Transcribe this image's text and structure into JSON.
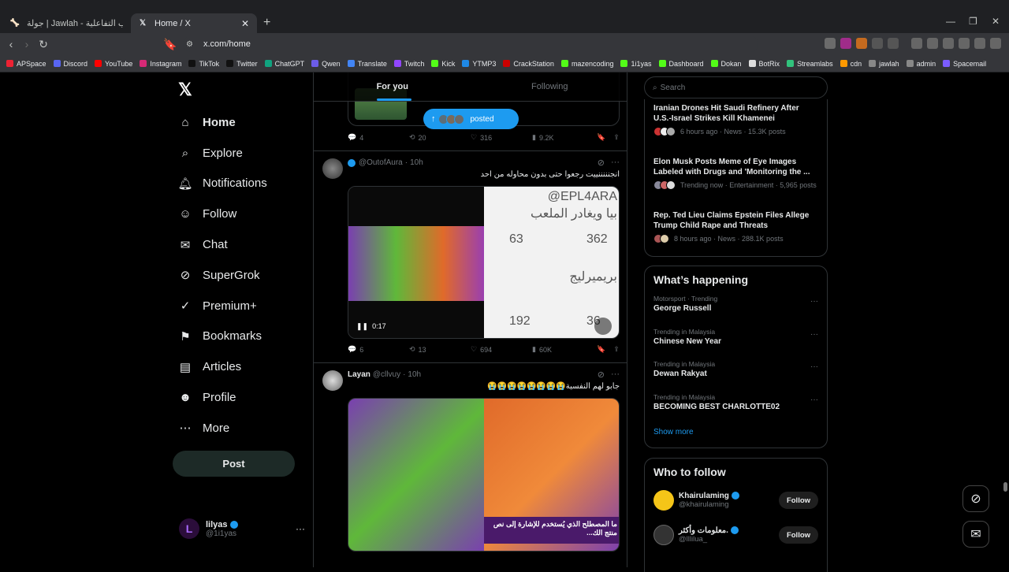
{
  "browser": {
    "tabs": [
      {
        "title": "جولة | Jawlah - منصة الألعاب التفاعلية",
        "icon": "jawlah-icon"
      },
      {
        "title": "Home / X",
        "icon": "x-icon"
      }
    ],
    "url": "x.com/home",
    "bookmarks": [
      "APSpace",
      "Discord",
      "YouTube",
      "Instagram",
      "TikTok",
      "Twitter",
      "ChatGPT",
      "Qwen",
      "Translate",
      "Twitch",
      "Kick",
      "YTMP3",
      "CrackStation",
      "mazencoding",
      "1i1yas",
      "Dashboard",
      "Dokan",
      "BotRix",
      "Streamlabs",
      "cdn",
      "jawlah",
      "admin",
      "Spacemail"
    ]
  },
  "nav": {
    "items": [
      {
        "label": "Home",
        "icon": "home-icon"
      },
      {
        "label": "Explore",
        "icon": "search-icon"
      },
      {
        "label": "Notifications",
        "icon": "bell-icon"
      },
      {
        "label": "Follow",
        "icon": "person-add-icon"
      },
      {
        "label": "Chat",
        "icon": "mail-icon"
      },
      {
        "label": "SuperGrok",
        "icon": "grok-icon"
      },
      {
        "label": "Premium+",
        "icon": "check-circle-icon"
      },
      {
        "label": "Bookmarks",
        "icon": "bookmark-icon"
      },
      {
        "label": "Articles",
        "icon": "articles-icon"
      },
      {
        "label": "Profile",
        "icon": "person-icon"
      },
      {
        "label": "More",
        "icon": "more-circle-icon"
      }
    ],
    "post_label": "Post",
    "account": {
      "name": "lilyas",
      "handle": "@1i1yas",
      "avatar_letter": "L"
    }
  },
  "feed": {
    "tabs": [
      "For you",
      "Following"
    ],
    "posted_pill": "posted",
    "prev_actions": {
      "replies": "4",
      "reposts": "20",
      "likes": "316",
      "views": "9.2K"
    },
    "tweets": [
      {
        "handle": "@OutofAura",
        "time": "10h",
        "text": "انجنننننييت رجعوا حتى بدون محاوله من احد",
        "duration": "0:17",
        "replies": "6",
        "reposts": "13",
        "likes": "694",
        "views": "60K",
        "media_overlay": {
          "handle": "@EPL4ARA",
          "line1": "بريميرليج",
          "line2": "بيا ويغادر الملعب",
          "c1": "63",
          "c2": "362",
          "c3": "192",
          "c4": "36"
        }
      },
      {
        "name": "Layan",
        "handle": "@cllvuy",
        "time": "10h",
        "text": "جابو لهم النفسية😭😭😭😭😭😭😭😭",
        "caption": "ما المصطلح الذي يُستخدم للإشارة إلى نص منتج الك..."
      }
    ]
  },
  "right": {
    "search_placeholder": "Search",
    "news": [
      {
        "headline": "Iranian Drones Hit Saudi Refinery After U.S.-Israel Strikes Kill Khamenei",
        "meta": "6 hours ago · News · 15.3K posts"
      },
      {
        "headline": "Elon Musk Posts Meme of Eye Images Labeled with Drugs and 'Monitoring the ...",
        "meta": "Trending now · Entertainment · 5,965 posts"
      },
      {
        "headline": "Rep. Ted Lieu Claims Epstein Files Allege Trump Child Rape and Threats",
        "meta": "8 hours ago · News · 288.1K posts"
      }
    ],
    "happening_title": "What’s happening",
    "trends": [
      {
        "context": "Motorsport · Trending",
        "topic": "George Russell"
      },
      {
        "context": "Trending in Malaysia",
        "topic": "Chinese New Year"
      },
      {
        "context": "Trending in Malaysia",
        "topic": "Dewan Rakyat"
      },
      {
        "context": "Trending in Malaysia",
        "topic": "BECOMING BEST CHARLOTTE02"
      }
    ],
    "show_more": "Show more",
    "wtf_title": "Who to follow",
    "follow_label": "Follow",
    "suggestions": [
      {
        "name": "Khairulaming",
        "handle": "@khairulaming"
      },
      {
        "name": "معلومات وأكثر.",
        "handle": "@lllilua_"
      }
    ]
  },
  "colors": {
    "accent": "#1d9bf0",
    "bg": "#000000",
    "border": "#2f3336"
  }
}
